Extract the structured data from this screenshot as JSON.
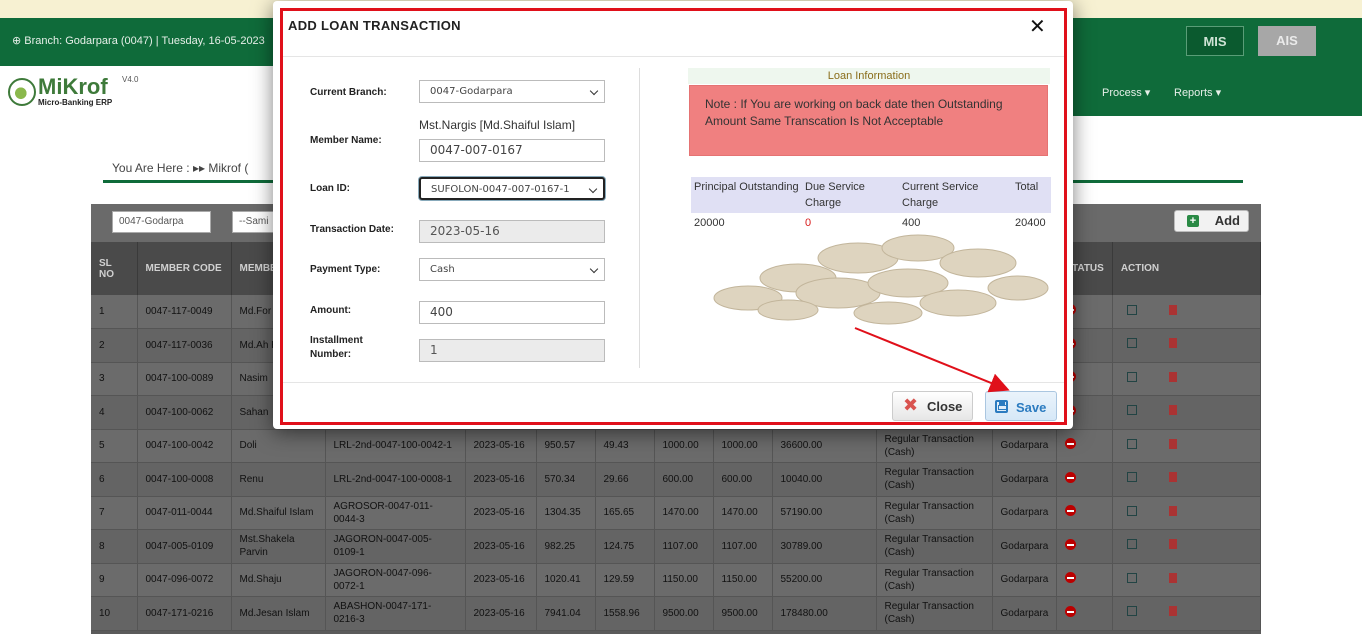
{
  "app": {
    "branch_line": "⊕ Branch: Godarpara (0047) | Tuesday, 16-05-2023",
    "mis": "MIS",
    "ais": "AIS",
    "logo": "MiKrof",
    "logo_version": "V4.0",
    "logo_sub": "Micro-Banking ERP",
    "nav": {
      "process": "Process ▾",
      "reports": "Reports ▾"
    },
    "breadcrumb": "You Are Here  :  ▸▸   Mikrof ("
  },
  "list": {
    "filter_branch": "0047-Godarpa",
    "filter_samity": "--Sami",
    "add_label": "Add",
    "headers": [
      "SL NO",
      "MEMBER CODE",
      "MEMBER NAME",
      "",
      "",
      "",
      "",
      "",
      "",
      "",
      "",
      "",
      "STATUS",
      "ACTION"
    ],
    "rows": [
      {
        "sl": "1",
        "code": "0047-117-0049",
        "name": "Md.For",
        "loan": "",
        "date": "",
        "p": "",
        "s": "",
        "amt": "",
        "paid": "",
        "bal": "",
        "type": "",
        "branch": ""
      },
      {
        "sl": "2",
        "code": "0047-117-0036",
        "name": "Md.Ah Habib",
        "loan": "",
        "date": "",
        "p": "",
        "s": "",
        "amt": "",
        "paid": "",
        "bal": "",
        "type": "",
        "branch": ""
      },
      {
        "sl": "3",
        "code": "0047-100-0089",
        "name": "Nasim",
        "loan": "",
        "date": "",
        "p": "",
        "s": "",
        "amt": "",
        "paid": "",
        "bal": "",
        "type": "",
        "branch": ""
      },
      {
        "sl": "4",
        "code": "0047-100-0062",
        "name": "Sahan",
        "loan": "",
        "date": "",
        "p": "",
        "s": "",
        "amt": "",
        "paid": "",
        "bal": "",
        "type": "",
        "branch": ""
      },
      {
        "sl": "5",
        "code": "0047-100-0042",
        "name": "Doli",
        "loan": "LRL-2nd-0047-100-0042-1",
        "date": "2023-05-16",
        "p": "950.57",
        "s": "49.43",
        "amt": "1000.00",
        "paid": "1000.00",
        "bal": "36600.00",
        "type": "Regular Transaction (Cash)",
        "branch": "Godarpara"
      },
      {
        "sl": "6",
        "code": "0047-100-0008",
        "name": "Renu",
        "loan": "LRL-2nd-0047-100-0008-1",
        "date": "2023-05-16",
        "p": "570.34",
        "s": "29.66",
        "amt": "600.00",
        "paid": "600.00",
        "bal": "10040.00",
        "type": "Regular Transaction (Cash)",
        "branch": "Godarpara"
      },
      {
        "sl": "7",
        "code": "0047-011-0044",
        "name": "Md.Shaiful Islam",
        "loan": "AGROSOR-0047-011-0044-3",
        "date": "2023-05-16",
        "p": "1304.35",
        "s": "165.65",
        "amt": "1470.00",
        "paid": "1470.00",
        "bal": "57190.00",
        "type": "Regular Transaction (Cash)",
        "branch": "Godarpara"
      },
      {
        "sl": "8",
        "code": "0047-005-0109",
        "name": "Mst.Shakela Parvin",
        "loan": "JAGORON-0047-005-0109-1",
        "date": "2023-05-16",
        "p": "982.25",
        "s": "124.75",
        "amt": "1107.00",
        "paid": "1107.00",
        "bal": "30789.00",
        "type": "Regular Transaction (Cash)",
        "branch": "Godarpara"
      },
      {
        "sl": "9",
        "code": "0047-096-0072",
        "name": "Md.Shaju",
        "loan": "JAGORON-0047-096-0072-1",
        "date": "2023-05-16",
        "p": "1020.41",
        "s": "129.59",
        "amt": "1150.00",
        "paid": "1150.00",
        "bal": "55200.00",
        "type": "Regular Transaction (Cash)",
        "branch": "Godarpara"
      },
      {
        "sl": "10",
        "code": "0047-171-0216",
        "name": "Md.Jesan Islam",
        "loan": "ABASHON-0047-171-0216-3",
        "date": "2023-05-16",
        "p": "7941.04",
        "s": "1558.96",
        "amt": "9500.00",
        "paid": "9500.00",
        "bal": "178480.00",
        "type": "Regular Transaction (Cash)",
        "branch": "Godarpara"
      }
    ]
  },
  "modal": {
    "title": "ADD LOAN TRANSACTION",
    "close_x": "✕",
    "labels": {
      "branch": "Current Branch:",
      "member": "Member Name:",
      "loan": "Loan ID:",
      "date": "Transaction Date:",
      "payment": "Payment Type:",
      "amount": "Amount:",
      "installment": "Installment Number:"
    },
    "values": {
      "branch": "0047-Godarpara",
      "member_display": "Mst.Nargis [Md.Shaiful Islam]",
      "member_code": "0047-007-0167",
      "loan": "SUFOLON-0047-007-0167-1",
      "date": "2023-05-16",
      "payment": "Cash",
      "amount": "400",
      "installment": "1"
    },
    "info": {
      "title": "Loan Information",
      "note": "Note : If You are working on back date then Outstanding Amount Same Transcation Is Not Acceptable",
      "headers": [
        "Principal Outstanding",
        "Due Service Charge",
        "Current Service Charge",
        "Total"
      ],
      "values": [
        "20000",
        "0",
        "400",
        "20400"
      ]
    },
    "close_label": "Close",
    "save_label": "Save"
  }
}
